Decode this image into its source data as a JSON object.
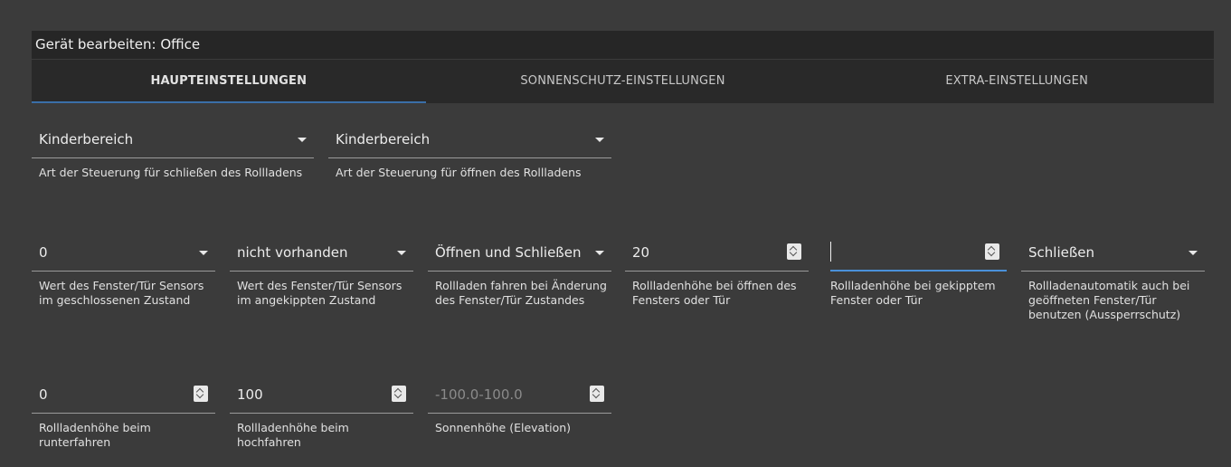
{
  "dialog": {
    "title": "Gerät bearbeiten: Office"
  },
  "tabs": [
    {
      "label": "HAUPTEINSTELLUNGEN",
      "active": true
    },
    {
      "label": "SONNENSCHUTZ-EINSTELLUNGEN",
      "active": false
    },
    {
      "label": "EXTRA-EINSTELLUNGEN",
      "active": false
    }
  ],
  "colors": {
    "background": "#3b3b3b",
    "titlebar": "#262626",
    "tabbar": "#292929",
    "tab_indicator": "#3a6fa8",
    "focus_underline": "#4a90d9"
  },
  "row1": {
    "close_control": {
      "value": "Kinderbereich",
      "label": "Art der Steuerung für schließen des Rollladens"
    },
    "open_control": {
      "value": "Kinderbereich",
      "label": "Art der Steuerung für öffnen des Rollladens"
    }
  },
  "row2": {
    "sensor_closed": {
      "value": "0",
      "label": "Wert des Fenster/Tür Sensors im geschlossenen Zustand"
    },
    "sensor_tilted": {
      "value": "nicht vorhanden",
      "label": "Wert des Fenster/Tür Sensors im angekippten Zustand"
    },
    "drive_on_change": {
      "value": "Öffnen und Schließen",
      "label": "Rollladen fahren bei Änderung des Fenster/Tür Zustandes"
    },
    "height_open_window": {
      "value": "20",
      "label": "Rollladenhöhe bei öffnen des Fensters oder Tür"
    },
    "height_tilted_window": {
      "value": "",
      "label": "Rollladenhöhe bei gekipptem Fenster oder Tür"
    },
    "lockout_protection": {
      "value": "Schließen",
      "label": "Rollladenautomatik auch bei geöffneten Fenster/Tür benutzen (Aussperrschutz)"
    }
  },
  "row3": {
    "height_down": {
      "value": "0",
      "label": "Rollladenhöhe beim runterfahren"
    },
    "height_up": {
      "value": "100",
      "label": "Rollladenhöhe beim hochfahren"
    },
    "elevation": {
      "placeholder": "-100.0-100.0",
      "label": "Sonnenhöhe (Elevation)"
    }
  },
  "icons": {
    "select_arrow": "chevron-down-icon",
    "number_spinner": "spinner-icon"
  }
}
